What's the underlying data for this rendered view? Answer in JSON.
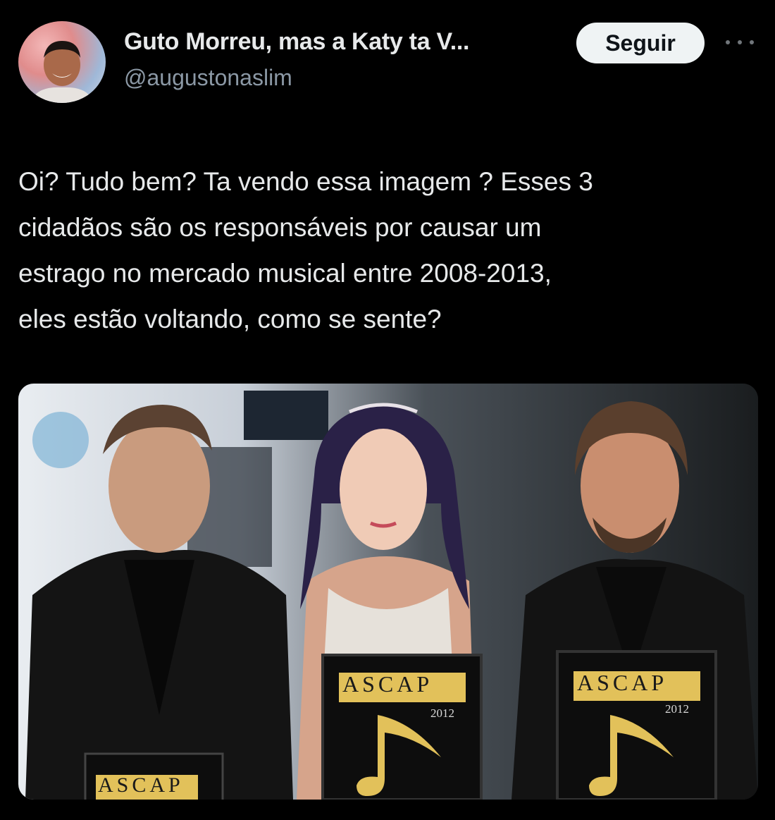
{
  "tweet": {
    "author": {
      "display_name": "Guto Morreu, mas a Katy ta V...",
      "handle": "@augustonaslim",
      "avatar_icon": "profile-photo"
    },
    "follow_label": "Seguir",
    "more_icon": "more-horizontal-icon",
    "text": "Oi? Tudo bem? Ta vendo essa imagem ? Esses 3\ncidadãos são os responsáveis por causar um\nestrago no mercado musical entre 2008-2013,\neles estão voltando, como se sente?",
    "media": {
      "plaques": [
        {
          "brand": "ASCAP",
          "year": ""
        },
        {
          "brand": "ASCAP",
          "year": "2012"
        },
        {
          "brand": "ASCAP",
          "year": "2012"
        }
      ]
    }
  },
  "colors": {
    "background": "#000000",
    "primary_text": "#e7e9ea",
    "secondary_text": "#8b98a5",
    "follow_bg": "#eff3f4",
    "plaque_gold": "#e2c15a"
  }
}
